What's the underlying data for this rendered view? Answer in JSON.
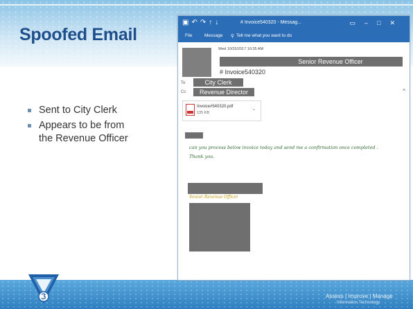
{
  "slide": {
    "title": "Spoofed Email",
    "bullets": [
      "Sent to City Clerk",
      "Appears to be from the Revenue Officer"
    ],
    "footer": {
      "tagline": "Assess | Improve | Manage",
      "subtitle": "Information Technology"
    },
    "colors": {
      "title": "#1e4f8c",
      "accent": "#2b6db6",
      "body_text": "#2e6b2e",
      "signature_title": "#c39a12"
    }
  },
  "email_window": {
    "title": "# Invoice540320 - Messag...",
    "ribbon": {
      "file": "File",
      "message": "Message",
      "tell_me": "Tell me what you want to do"
    },
    "titlebar_icons": [
      "save-icon",
      "undo-icon",
      "redo-icon",
      "up-icon",
      "down-icon"
    ],
    "window_controls": [
      "ribbon-options-icon",
      "minimize-icon",
      "maximize-icon",
      "close-icon"
    ],
    "header": {
      "date": "Wed 10/25/2017 10:35 AM",
      "sender": "Senior Revenue Officer",
      "subject": "# Invoice540320",
      "to_label": "To",
      "to": "City Clerk",
      "cc_label": "Cc",
      "cc": "Revenue Director"
    },
    "attachment": {
      "name": "Invoice#540320.pdf",
      "size": "135 KB"
    },
    "body": {
      "line1": "can you process below invoice today and send me a confirmation once completed .",
      "line2": "Thank you."
    },
    "signature": {
      "title": "Senior Revenue Officer"
    }
  }
}
